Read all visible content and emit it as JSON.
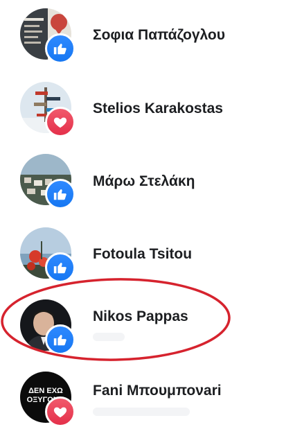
{
  "reactions_list": {
    "items": [
      {
        "name": "Σοφια Παπάζογλου",
        "reaction": "like",
        "avatar_palette": [
          "#3a3f44",
          "#c9463d",
          "#e6e2da"
        ]
      },
      {
        "name": "Stelios Karakostas",
        "reaction": "love",
        "avatar_palette": [
          "#dde7ef",
          "#6b5b4e",
          "#c0392b"
        ]
      },
      {
        "name": "Μάρω Στελάκη",
        "reaction": "like",
        "avatar_palette": [
          "#9db7c9",
          "#d6d0c4",
          "#4b5a4c"
        ]
      },
      {
        "name": "Fotoula Tsitou",
        "reaction": "like",
        "avatar_palette": [
          "#b7cde0",
          "#d63a2a",
          "#3d4a3a"
        ]
      },
      {
        "name": "Nikos Pappas",
        "reaction": "like",
        "avatar_palette": [
          "#15171b",
          "#d9b39a",
          "#2a2d33"
        ]
      },
      {
        "name": "Fani Μπουμπονari",
        "reaction": "love",
        "avatar_palette": [
          "#0b0b0b",
          "#ffffff",
          "#1a1a1a"
        ],
        "avatar_text_1": "ΔΕΝ ΕΧΩ",
        "avatar_text_2": "ΟΞΥΓΟΝΟ"
      }
    ]
  },
  "highlight": {
    "color": "#d6232e",
    "target": "Nikos Pappas"
  },
  "colors": {
    "like": "#1877f2",
    "love": "#f33e58",
    "name_text": "#1c1e21"
  }
}
